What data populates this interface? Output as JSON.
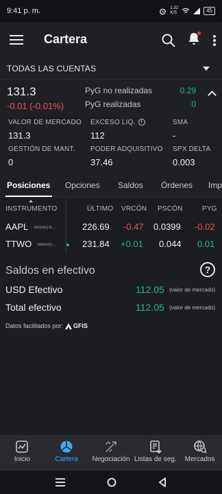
{
  "status_bar": {
    "time": "9:41 p. m.",
    "net_speed": "1.32\nK/S",
    "battery": "45"
  },
  "app_bar": {
    "title": "Cartera"
  },
  "account": {
    "label": "TODAS LAS CUENTAS"
  },
  "summary": {
    "value": "131.3",
    "change": "-0.01 (-0.01%)",
    "pyg_unrealized_label": "PyG no realizadas",
    "pyg_unrealized_value": "0.29",
    "pyg_realized_label": "PyG realizadas",
    "pyg_realized_value": "0",
    "metrics": [
      {
        "label": "VALOR DE MERCADO",
        "value": "131.3"
      },
      {
        "label": "EXCESO LIQ.",
        "value": "112"
      },
      {
        "label": "SMA",
        "value": "-"
      },
      {
        "label": "GESTIÓN DE MANT.",
        "value": "0"
      },
      {
        "label": "PODER ADQUISITIVO",
        "value": "37.46"
      },
      {
        "label": "SPX DELTA",
        "value": "0.003"
      }
    ]
  },
  "tabs": [
    "Posiciones",
    "Opciones",
    "Saldos",
    "Órdenes",
    "Imp"
  ],
  "positions": {
    "headers": [
      "INSTRUMENTO",
      "ÚLTIMO",
      "VRCÓN",
      "PSCÓN",
      "PYG"
    ],
    "rows": [
      {
        "symbol": "AAPL",
        "exchange": "NASDAQ.N...",
        "last": "226.69",
        "change": "-0.47",
        "pscon": "0.0399",
        "pyg": "-0.02"
      },
      {
        "symbol": "TTWO",
        "exchange": "NASDAQ....",
        "last": "231.84",
        "change": "+0.01",
        "pscon": "0.044",
        "pyg": "0.01"
      }
    ]
  },
  "cash": {
    "title": "Saldos en efectivo",
    "rows": [
      {
        "label": "USD Efectivo",
        "value": "112.05",
        "note": "(valor de mercado)"
      },
      {
        "label": "Total efectivo",
        "value": "112.05",
        "note": "(valor de mercado)"
      }
    ],
    "data_by": "Datos facilitados por:",
    "provider": "GFIS"
  },
  "bottom_nav": [
    "Inicio",
    "Cartera",
    "Negociación",
    "Listas de seg.",
    "Mercados"
  ],
  "colors": {
    "accent": "#3aa8ff",
    "positive": "#23b39a",
    "negative": "#e0555a"
  }
}
